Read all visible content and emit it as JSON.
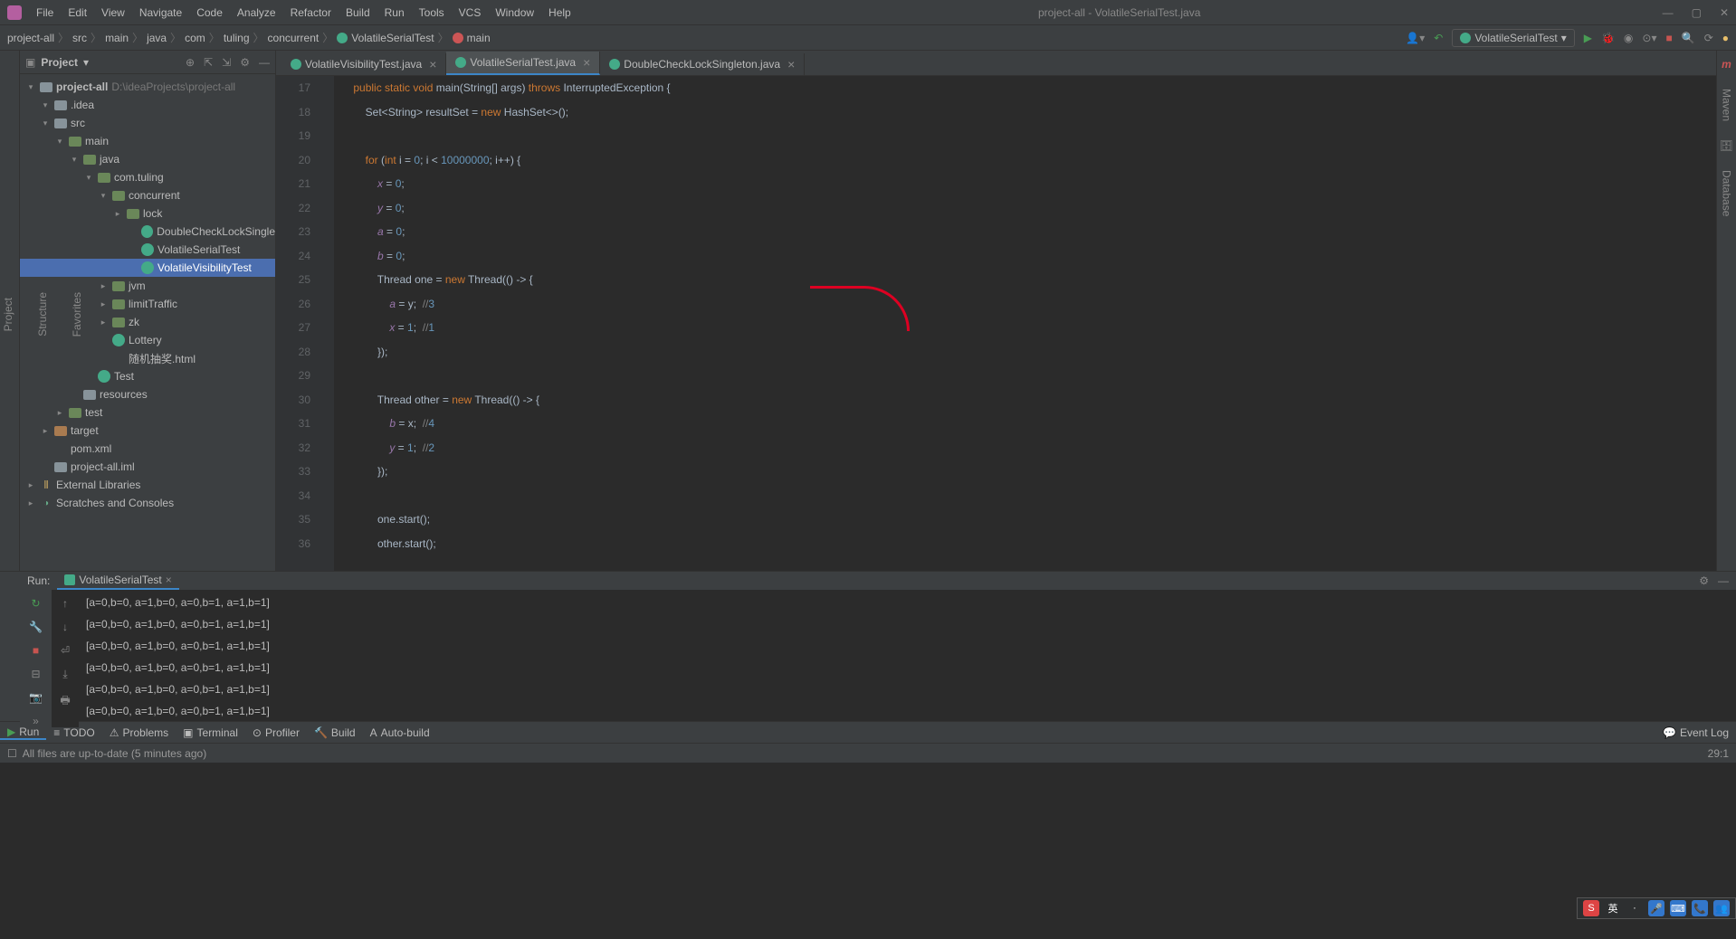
{
  "window": {
    "title": "project-all - VolatileSerialTest.java"
  },
  "menu": [
    "File",
    "Edit",
    "View",
    "Navigate",
    "Code",
    "Analyze",
    "Refactor",
    "Build",
    "Run",
    "Tools",
    "VCS",
    "Window",
    "Help"
  ],
  "breadcrumbs": [
    "project-all",
    "src",
    "main",
    "java",
    "com",
    "tuling",
    "concurrent",
    "VolatileSerialTest",
    "main"
  ],
  "run_config": "VolatileSerialTest",
  "project": {
    "title": "Project",
    "root": {
      "name": "project-all",
      "path": "D:\\ideaProjects\\project-all"
    },
    "tree": [
      {
        "lvl": 1,
        "arrow": "▾",
        "ico": "folder grey",
        "label": ".idea"
      },
      {
        "lvl": 1,
        "arrow": "▾",
        "ico": "folder grey",
        "label": "src"
      },
      {
        "lvl": 2,
        "arrow": "▾",
        "ico": "folder",
        "label": "main"
      },
      {
        "lvl": 3,
        "arrow": "▾",
        "ico": "folder",
        "label": "java"
      },
      {
        "lvl": 4,
        "arrow": "▾",
        "ico": "folder",
        "label": "com.tuling"
      },
      {
        "lvl": 5,
        "arrow": "▾",
        "ico": "folder",
        "label": "concurrent"
      },
      {
        "lvl": 6,
        "arrow": "▸",
        "ico": "folder",
        "label": "lock"
      },
      {
        "lvl": 7,
        "arrow": "",
        "ico": "cls",
        "label": "DoubleCheckLockSingle"
      },
      {
        "lvl": 7,
        "arrow": "",
        "ico": "cls",
        "label": "VolatileSerialTest"
      },
      {
        "lvl": 7,
        "arrow": "",
        "ico": "cls",
        "label": "VolatileVisibilityTest",
        "sel": true
      },
      {
        "lvl": 5,
        "arrow": "▸",
        "ico": "folder",
        "label": "jvm"
      },
      {
        "lvl": 5,
        "arrow": "▸",
        "ico": "folder",
        "label": "limitTraffic"
      },
      {
        "lvl": 5,
        "arrow": "▸",
        "ico": "folder",
        "label": "zk"
      },
      {
        "lvl": 5,
        "arrow": "",
        "ico": "cls",
        "label": "Lottery"
      },
      {
        "lvl": 5,
        "arrow": "",
        "ico": "html",
        "label": "随机抽奖.html"
      },
      {
        "lvl": 4,
        "arrow": "",
        "ico": "cls",
        "label": "Test"
      },
      {
        "lvl": 3,
        "arrow": "",
        "ico": "folder grey",
        "label": "resources"
      },
      {
        "lvl": 2,
        "arrow": "▸",
        "ico": "folder",
        "label": "test"
      },
      {
        "lvl": 1,
        "arrow": "▸",
        "ico": "folder orng",
        "label": "target"
      },
      {
        "lvl": 1,
        "arrow": "",
        "ico": "xml",
        "label": "pom.xml"
      },
      {
        "lvl": 1,
        "arrow": "",
        "ico": "folder grey",
        "label": "project-all.iml"
      }
    ],
    "extra": [
      "External Libraries",
      "Scratches and Consoles"
    ]
  },
  "tabs": [
    {
      "label": "VolatileVisibilityTest.java",
      "active": false
    },
    {
      "label": "VolatileSerialTest.java",
      "active": true
    },
    {
      "label": "DoubleCheckLockSingleton.java",
      "active": false
    }
  ],
  "code": {
    "first_line": 17,
    "lines": [
      "    public static void main(String[] args) throws InterruptedException {",
      "        Set<String> resultSet = new HashSet<>();",
      "",
      "        for (int i = 0; i < 10000000; i++) {",
      "            x = 0;",
      "            y = 0;",
      "            a = 0;",
      "            b = 0;",
      "            Thread one = new Thread(() -> {",
      "                a = y;  //3",
      "                x = 1;  //1",
      "            });",
      "",
      "            Thread other = new Thread(() -> {",
      "                b = x;  //4",
      "                y = 1;  //2",
      "            });",
      "",
      "            one.start();",
      "            other.start();"
    ]
  },
  "run": {
    "label": "Run:",
    "config": "VolatileSerialTest",
    "output": [
      "[a=0,b=0, a=1,b=0, a=0,b=1, a=1,b=1]",
      "[a=0,b=0, a=1,b=0, a=0,b=1, a=1,b=1]",
      "[a=0,b=0, a=1,b=0, a=0,b=1, a=1,b=1]",
      "[a=0,b=0, a=1,b=0, a=0,b=1, a=1,b=1]",
      "[a=0,b=0, a=1,b=0, a=0,b=1, a=1,b=1]",
      "[a=0,b=0, a=1,b=0, a=0,b=1, a=1,b=1]"
    ]
  },
  "bottom_tools": [
    "Run",
    "TODO",
    "Problems",
    "Terminal",
    "Profiler",
    "Build",
    "Auto-build"
  ],
  "status": {
    "left": "All files are up-to-date (5 minutes ago)",
    "pos": "29:1",
    "event": "Event Log"
  },
  "right_tabs": [
    "Maven",
    "Database"
  ],
  "left_tabs": [
    "Project",
    "Structure",
    "Favorites"
  ],
  "ime": [
    "S",
    "英",
    "·",
    "🎤",
    "⌨",
    "📞",
    "👥"
  ]
}
